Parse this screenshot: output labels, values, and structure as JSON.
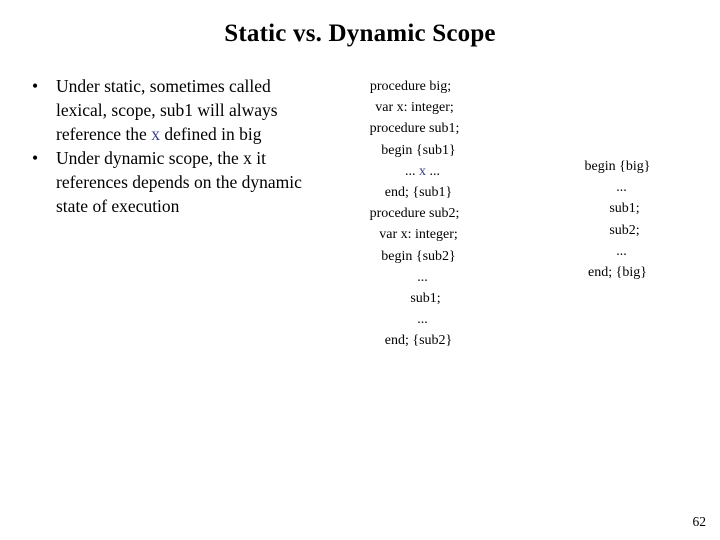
{
  "slide": {
    "title": "Static vs. Dynamic Scope",
    "page_number": "62",
    "background_color": "#ffffff",
    "text_color": "#000000",
    "highlight_color": "#3b3b8c"
  },
  "bullets": [
    {
      "marker": "•",
      "text_before": "Under static, sometimes called lexical, scope, sub1 will always reference the ",
      "highlight": "x",
      "text_after": " defined in big",
      "full_text": "Under static, sometimes called lexical, scope, sub1 will always reference the x defined in big"
    },
    {
      "marker": "•",
      "text_before": "Under dynamic scope, the x it references depends on the dynamic state of execution",
      "highlight": "",
      "text_after": "",
      "full_text": "Under dynamic scope, the x it references depends on the dynamic state of execution"
    }
  ],
  "code_center": {
    "lines": [
      {
        "text": "procedure big;",
        "indent": 0,
        "highlight": false
      },
      {
        "text": "var x: integer;",
        "indent": 1,
        "highlight": false
      },
      {
        "text": "procedure sub1;",
        "indent": 1,
        "highlight": false
      },
      {
        "text": "begin {sub1}",
        "indent": 2,
        "highlight": false
      },
      {
        "text": "... x ...",
        "indent": 3,
        "highlight": true
      },
      {
        "text": "end; {sub1}",
        "indent": 2,
        "highlight": false
      },
      {
        "text": "procedure sub2;",
        "indent": 1,
        "highlight": false
      },
      {
        "text": "var x: integer;",
        "indent": 2,
        "highlight": false
      },
      {
        "text": "begin {sub2}",
        "indent": 2,
        "highlight": false
      },
      {
        "text": "...",
        "indent": 3,
        "highlight": false
      },
      {
        "text": "sub1;",
        "indent": 4,
        "highlight": false
      },
      {
        "text": "...",
        "indent": 3,
        "highlight": false
      },
      {
        "text": "end; {sub2}",
        "indent": 2,
        "highlight": false
      }
    ],
    "highlight_prefix": "... ",
    "highlight_token": "x",
    "highlight_suffix": " ..."
  },
  "code_right": {
    "lines": [
      {
        "text": "begin {big}",
        "indent": 0
      },
      {
        "text": "...",
        "indent": 1
      },
      {
        "text": "sub1;",
        "indent": 2
      },
      {
        "text": "sub2;",
        "indent": 2
      },
      {
        "text": "...",
        "indent": 1
      },
      {
        "text": "end; {big}",
        "indent": 0
      }
    ]
  }
}
